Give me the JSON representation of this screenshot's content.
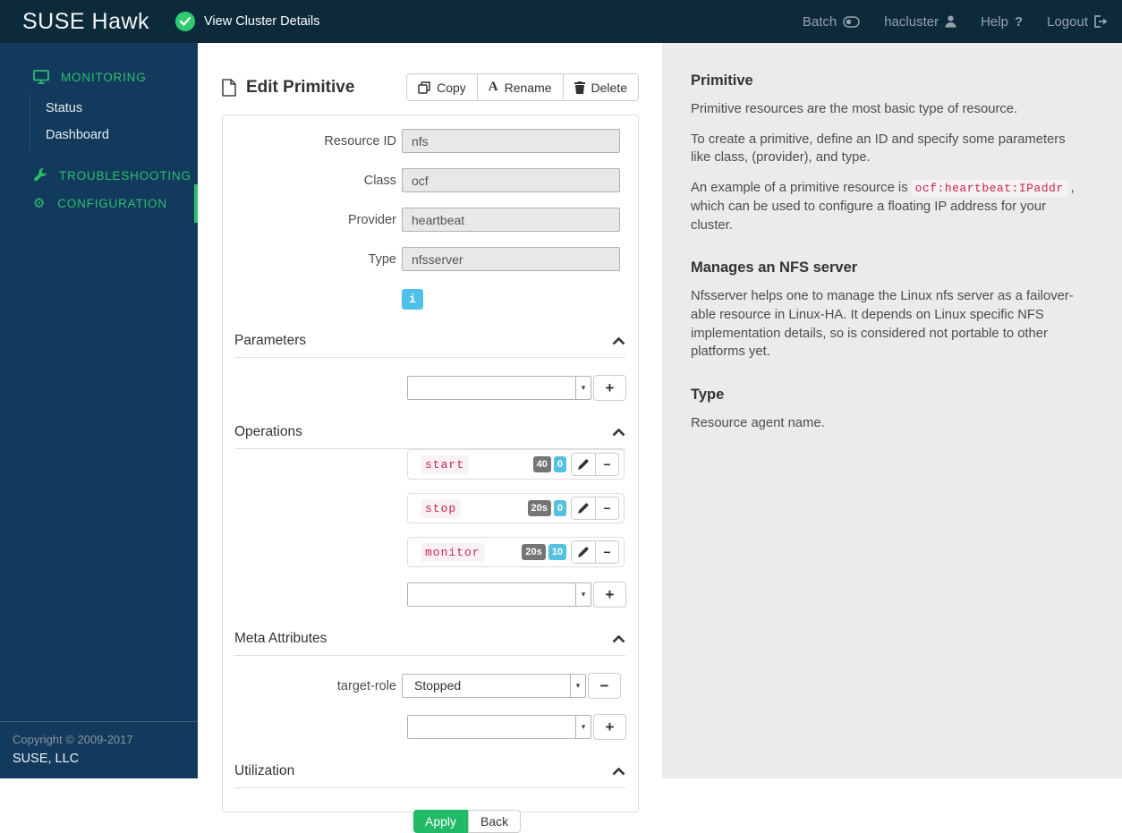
{
  "colors": {
    "topbar": "#0c2a3a",
    "sidebar": "#113a5c",
    "nav_green": "#2ebd6e",
    "check_green": "#2ecc71",
    "info_blue": "#4fc1e9",
    "badge_gray": "#757575",
    "badge_blue": "#55c0e0",
    "code_red": "#c7254e",
    "code_bg": "#f9f2f4",
    "apply_green": "#21ba66",
    "panel_gray": "#ebebeb"
  },
  "topbar": {
    "brand": "SUSE Hawk",
    "view_cluster_details": "View Cluster Details",
    "batch_label": "Batch",
    "username": "hacluster",
    "help_label": "Help",
    "help_glyph": "?",
    "logout_label": "Logout"
  },
  "sidebar": {
    "monitoring": "MONITORING",
    "status": "Status",
    "dashboard": "Dashboard",
    "troubleshooting": "TROUBLESHOOTING",
    "configuration": "CONFIGURATION",
    "copyright": "Copyright © 2009-2017",
    "company": "SUSE, LLC"
  },
  "main": {
    "title": "Edit Primitive",
    "toolbar": {
      "copy": "Copy",
      "rename": "Rename",
      "rename_glyph": "A",
      "delete": "Delete"
    },
    "fields": [
      {
        "label": "Resource ID",
        "value": "nfs"
      },
      {
        "label": "Class",
        "value": "ocf"
      },
      {
        "label": "Provider",
        "value": "heartbeat"
      },
      {
        "label": "Type",
        "value": "nfsserver"
      }
    ],
    "info_glyph": "i",
    "sections": {
      "parameters": "Parameters",
      "operations": "Operations",
      "meta_attributes": "Meta Attributes",
      "utilization": "Utilization"
    },
    "operations": [
      {
        "name": "start",
        "timeout": "40",
        "interval": "0"
      },
      {
        "name": "stop",
        "timeout": "20s",
        "interval": "0"
      },
      {
        "name": "monitor",
        "timeout": "20s",
        "interval": "10"
      }
    ],
    "meta_attributes": [
      {
        "label": "target-role",
        "value": "Stopped"
      }
    ],
    "glyphs": {
      "plus": "+",
      "minus": "−",
      "caret": "▾"
    },
    "buttons": {
      "apply": "Apply",
      "back": "Back"
    }
  },
  "help_panel": {
    "primitive": {
      "title": "Primitive",
      "p1": "Primitive resources are the most basic type of resource.",
      "p2": "To create a primitive, define an ID and specify some parameters like class, (provider), and type.",
      "p3_before": "An example of a primitive resource is",
      "p3_code": "ocf:heartbeat:IPaddr",
      "p3_after": ", which can be used to configure a floating IP address for your cluster."
    },
    "nfs": {
      "title": "Manages an NFS server",
      "body": "Nfsserver helps one to manage the Linux nfs server as a failover-able resource in Linux-HA. It depends on Linux specific NFS implementation details, so is considered not portable to other platforms yet."
    },
    "type": {
      "title": "Type",
      "body": "Resource agent name."
    }
  }
}
